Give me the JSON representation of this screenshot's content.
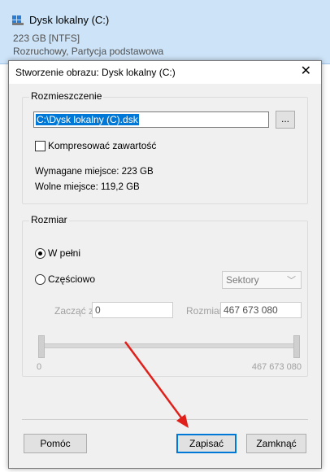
{
  "background": {
    "disk_name": "Dysk lokalny (C:)",
    "disk_size_fs": "223 GB [NTFS]",
    "disk_description": "Rozruchowy, Partycja podstawowa",
    "disk_icon": "disk-drive-icon"
  },
  "dialog": {
    "title": "Stworzenie obrazu: Dysk lokalny (C:)",
    "close_label": "✕",
    "location": {
      "group_title": "Rozmieszczenie",
      "path_value": "C:\\Dysk lokalny (C).dsk",
      "browse_label": "...",
      "compress_label": "Kompresować zawartość",
      "compress_checked": false,
      "required_space": "Wymagane miejsce: 223 GB",
      "free_space": "Wolne miejsce: 119,2 GB"
    },
    "size": {
      "group_title": "Rozmiar",
      "full_label": "W pełni",
      "full_selected": true,
      "partial_label": "Częściowo",
      "unit_select_value": "Sektory",
      "start_label": "Zacząć z",
      "start_value": "0",
      "size_label": "Rozmiar",
      "size_value": "467 673 080",
      "slider_min": "0",
      "slider_max": "467 673 080"
    },
    "buttons": {
      "help": "Pomóc",
      "save": "Zapisać",
      "close": "Zamknąć"
    }
  },
  "annotation_color": "#e0201b"
}
